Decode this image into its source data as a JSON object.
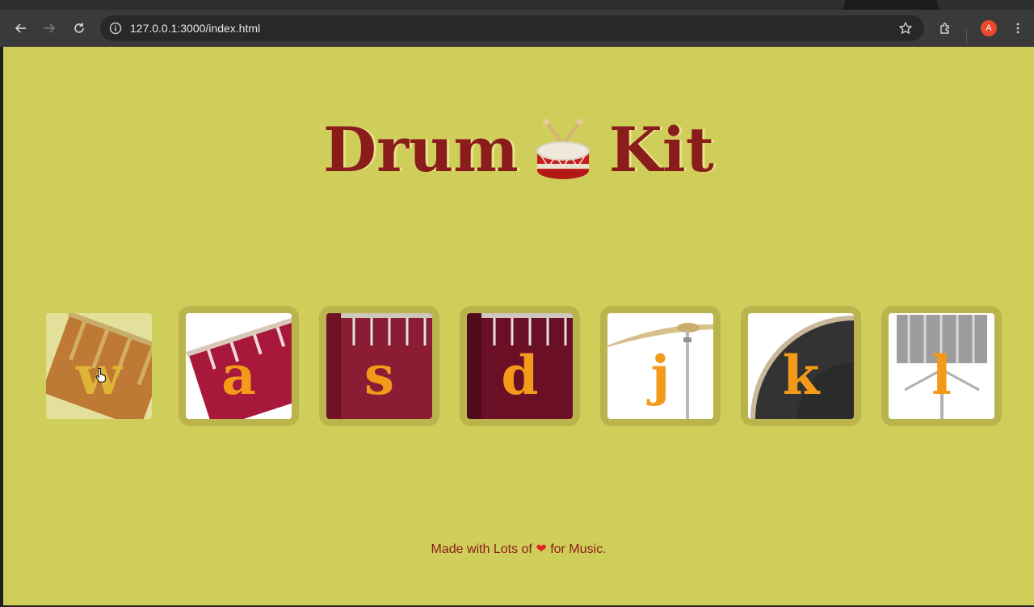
{
  "browser": {
    "url": "127.0.0.1:3000/index.html",
    "profile_initial": "A"
  },
  "page": {
    "title_left": "Drum",
    "title_right": "Kit",
    "footer_before": "Made with Lots of",
    "footer_heart": "❤",
    "footer_after": "for Music."
  },
  "drums": [
    {
      "key": "w",
      "instrument": "tom-1",
      "pressed": true
    },
    {
      "key": "a",
      "instrument": "tom-2",
      "pressed": false
    },
    {
      "key": "s",
      "instrument": "tom-3",
      "pressed": false
    },
    {
      "key": "d",
      "instrument": "tom-4",
      "pressed": false
    },
    {
      "key": "j",
      "instrument": "crash",
      "pressed": false
    },
    {
      "key": "k",
      "instrument": "kick-bass",
      "pressed": false
    },
    {
      "key": "l",
      "instrument": "snare",
      "pressed": false
    }
  ],
  "colors": {
    "page_background": "#d0ce5a",
    "title": "#8b1c1c",
    "key_letter": "#f39a1a",
    "button_frame": "#b9b44c"
  }
}
